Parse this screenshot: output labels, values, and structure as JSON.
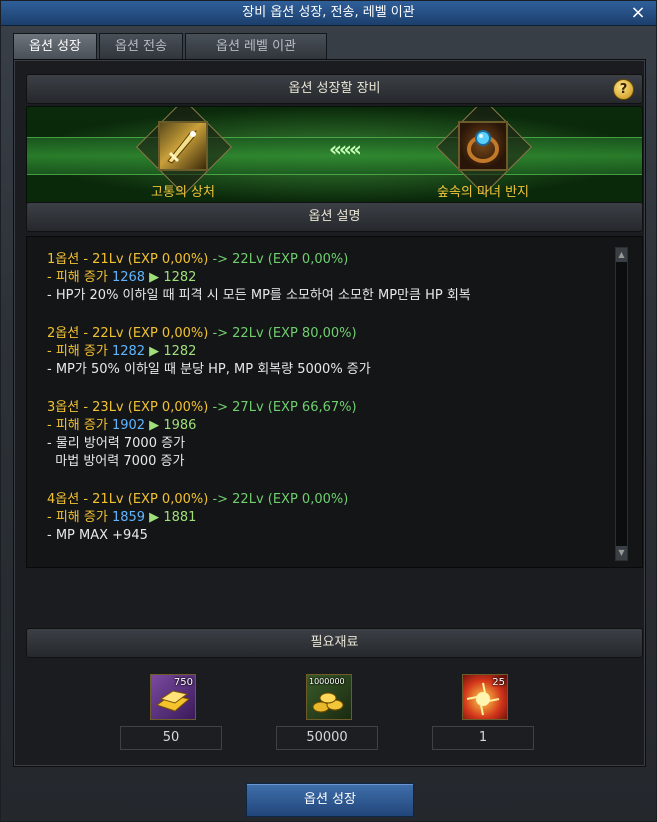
{
  "window": {
    "title": "장비 옵션 성장, 전송, 레벨 이관",
    "close_label": "×"
  },
  "tabs": [
    {
      "label": "옵션 성장",
      "active": true
    },
    {
      "label": "옵션 전송",
      "active": false
    },
    {
      "label": "옵션 레벨 이관",
      "active": false
    }
  ],
  "equip_section": {
    "title": "옵션 성장할 장비",
    "help_label": "?",
    "source_item": {
      "name": "고통의 상처",
      "icon": "sword-icon"
    },
    "target_item": {
      "name": "숲속의 마녀 반지",
      "icon": "ring-icon"
    },
    "arrow": "«««"
  },
  "desc_section": {
    "title": "옵션 설명",
    "options": [
      {
        "header": "1옵션 - 21Lv (EXP 0,00%)",
        "arrow_text": "-> 22Lv (EXP 0,00%)",
        "damage_prefix": "- 피해 증가",
        "damage_from": "1268",
        "damage_arrow": "▶",
        "damage_to": "1282",
        "effects": [
          "- HP가 20% 이하일 때 피격 시 모든 MP를 소모하여 소모한 MP만큼 HP 회복"
        ]
      },
      {
        "header": "2옵션 - 22Lv (EXP 0,00%)",
        "arrow_text": "-> 22Lv (EXP 80,00%)",
        "damage_prefix": "- 피해 증가",
        "damage_from": "1282",
        "damage_arrow": "▶",
        "damage_to": "1282",
        "effects": [
          "- MP가 50% 이하일 때 분당 HP, MP 회복량 5000% 증가"
        ]
      },
      {
        "header": "3옵션 - 23Lv (EXP 0,00%)",
        "arrow_text": "-> 27Lv (EXP 66,67%)",
        "damage_prefix": "- 피해 증가",
        "damage_from": "1902",
        "damage_arrow": "▶",
        "damage_to": "1986",
        "effects": [
          "- 물리 방어력 7000 증가",
          "  마법 방어력 7000 증가"
        ]
      },
      {
        "header": "4옵션 - 21Lv (EXP 0,00%)",
        "arrow_text": "-> 22Lv (EXP 0,00%)",
        "damage_prefix": "- 피해 증가",
        "damage_from": "1859",
        "damage_arrow": "▶",
        "damage_to": "1881",
        "effects": [
          "- MP MAX +945"
        ]
      }
    ]
  },
  "materials_section": {
    "title": "필요재료",
    "items": [
      {
        "icon": "gold-bar-icon",
        "badge": "750",
        "amount": "50"
      },
      {
        "icon": "coin-pile-icon",
        "badge": "1000000",
        "amount": "50000"
      },
      {
        "icon": "sunburst-icon",
        "badge": "25",
        "amount": "1"
      }
    ]
  },
  "action_button": {
    "label": "옵션 성장"
  },
  "colors": {
    "title_blue": "#2f5f9a",
    "gold_text": "#f0c43a",
    "exp_green": "#6fcf6f",
    "value_blue": "#5fb6ff"
  }
}
